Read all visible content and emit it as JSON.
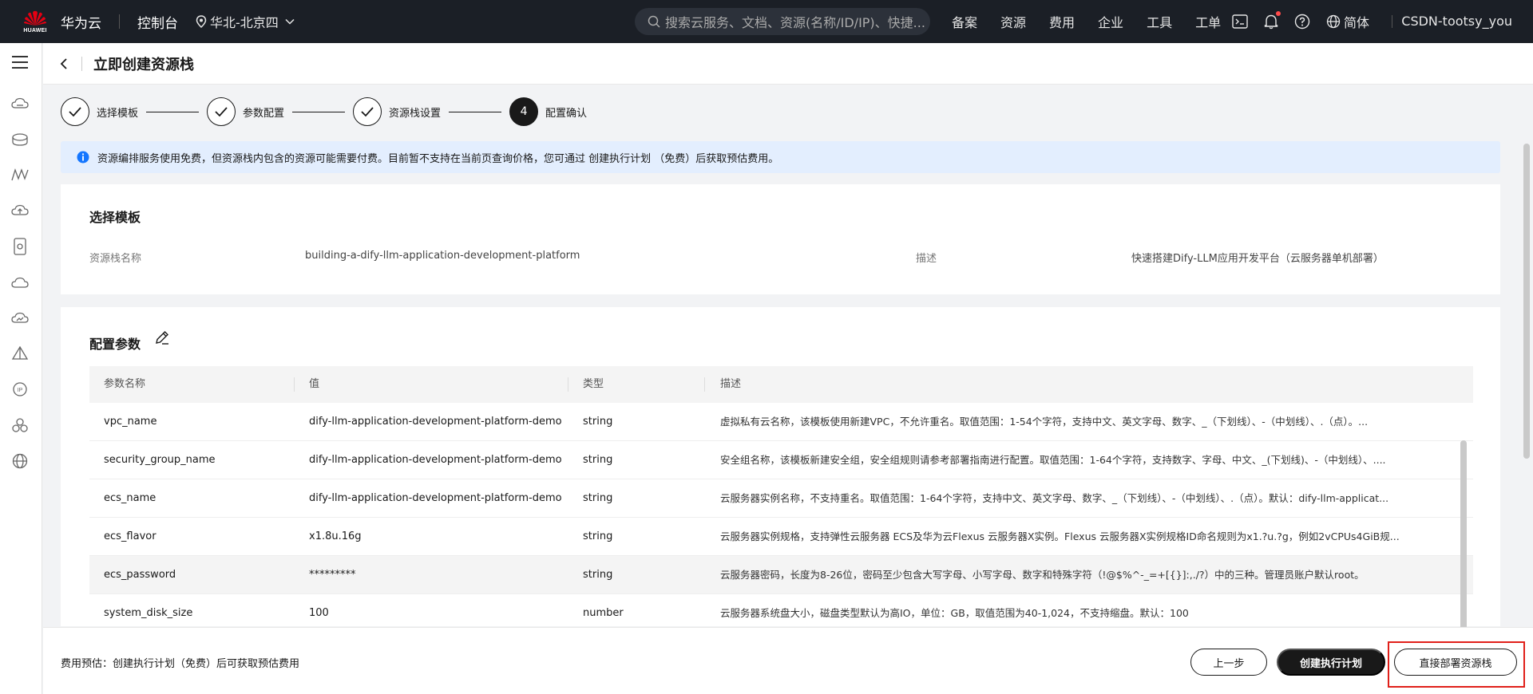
{
  "topbar": {
    "logo_text": "HUAWEI",
    "brand": "华为云",
    "console": "控制台",
    "region": "华北-北京四",
    "search_placeholder": "搜索云服务、文档、资源(名称/ID/IP)、快捷...",
    "nav": [
      "备案",
      "资源",
      "费用",
      "企业",
      "工具",
      "工单"
    ],
    "language": "简体",
    "user": "CSDN-tootsy_you"
  },
  "header": {
    "title": "立即创建资源栈"
  },
  "steps": [
    {
      "label": "选择模板",
      "done": true
    },
    {
      "label": "参数配置",
      "done": true
    },
    {
      "label": "资源栈设置",
      "done": true
    },
    {
      "label": "配置确认",
      "number": "4",
      "active": true
    }
  ],
  "info": {
    "text": "资源编排服务使用免费，但资源栈内包含的资源可能需要付费。目前暂不支持在当前页查询价格，您可通过 创建执行计划 （免费）后获取预估费用。"
  },
  "template_card": {
    "title": "选择模板",
    "stack_name_label": "资源栈名称",
    "stack_name_value": "building-a-dify-llm-application-development-platform",
    "desc_label": "描述",
    "desc_value": "快速搭建Dify-LLM应用开发平台（云服务器单机部署）"
  },
  "params_card": {
    "title": "配置参数",
    "columns": [
      "参数名称",
      "值",
      "类型",
      "描述"
    ],
    "rows": [
      {
        "name": "vpc_name",
        "value": "dify-llm-application-development-platform-demo",
        "type": "string",
        "desc": "虚拟私有云名称，该模板使用新建VPC，不允许重名。取值范围：1-54个字符，支持中文、英文字母、数字、_（下划线）、-（中划线）、.（点）。..."
      },
      {
        "name": "security_group_name",
        "value": "dify-llm-application-development-platform-demo",
        "type": "string",
        "desc": "安全组名称，该模板新建安全组，安全组规则请参考部署指南进行配置。取值范围：1-64个字符，支持数字、字母、中文、_(下划线)、-（中划线）、...."
      },
      {
        "name": "ecs_name",
        "value": "dify-llm-application-development-platform-demo",
        "type": "string",
        "desc": "云服务器实例名称，不支持重名。取值范围：1-64个字符，支持中文、英文字母、数字、_（下划线）、-（中划线）、.（点）。默认：dify-llm-applicat..."
      },
      {
        "name": "ecs_flavor",
        "value": "x1.8u.16g",
        "type": "string",
        "desc": "云服务器实例规格，支持弹性云服务器 ECS及华为云Flexus 云服务器X实例。Flexus 云服务器X实例规格ID命名规则为x1.?u.?g，例如2vCPUs4GiB规..."
      },
      {
        "name": "ecs_password",
        "value": "*********",
        "type": "string",
        "desc": "云服务器密码，长度为8-26位，密码至少包含大写字母、小写字母、数字和特殊字符（!@$%^-_=+[{}]:,./?）中的三种。管理员账户默认root。"
      },
      {
        "name": "system_disk_size",
        "value": "100",
        "type": "number",
        "desc": "云服务器系统盘大小，磁盘类型默认为高IO，单位：GB，取值范围为40-1,024，不支持缩盘。默认：100"
      }
    ]
  },
  "footer": {
    "fee_text": "费用预估：创建执行计划（免费）后可获取预估费用",
    "prev": "上一步",
    "plan": "创建执行计划",
    "deploy": "直接部署资源栈"
  }
}
